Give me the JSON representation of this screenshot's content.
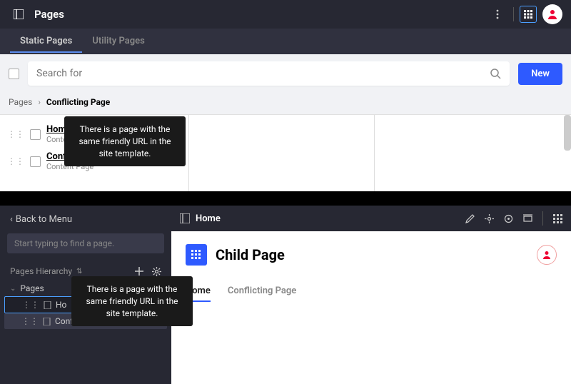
{
  "header": {
    "title": "Pages"
  },
  "tabs": [
    {
      "label": "Static Pages",
      "active": true
    },
    {
      "label": "Utility Pages",
      "active": false
    }
  ],
  "search": {
    "placeholder": "Search for"
  },
  "new_button": "New",
  "breadcrumb": {
    "root": "Pages",
    "current": "Conflicting Page"
  },
  "list": [
    {
      "title": "Home",
      "subtitle": "Content Page"
    },
    {
      "title": "Conflicting Pa...",
      "subtitle": "Content Page",
      "warning": true
    }
  ],
  "tooltip": "There is a page with the same friendly URL in the site template.",
  "sidebar": {
    "back": "Back to Menu",
    "find_placeholder": "Start typing to find a page.",
    "hierarchy_label": "Pages Hierarchy",
    "tree_root": "Pages",
    "tree": [
      {
        "label": "Home",
        "truncated": "Ho"
      },
      {
        "label": "Conflicting Page",
        "warning": true
      }
    ]
  },
  "tooltip2": "There is a page with the same friendly URL in the site template.",
  "main": {
    "title": "Home",
    "child_title": "Child Page",
    "tabs": [
      {
        "label": "Home",
        "active": true
      },
      {
        "label": "Conflicting Page",
        "active": false
      }
    ]
  }
}
